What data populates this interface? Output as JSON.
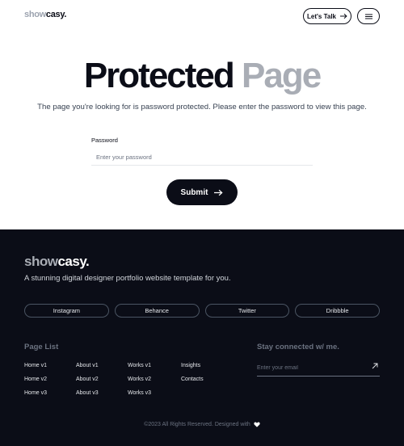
{
  "header": {
    "logo_light": "show",
    "logo_dark": "casy.",
    "talk_label": "Let's Talk",
    "talk_icon": "arrow-right-icon",
    "menu_icon": "hamburger-menu-icon"
  },
  "main": {
    "title_dark": "Protected",
    "title_light": "Page",
    "subtitle": "The page you're looking for is password protected. Please enter the password to view this page.",
    "password_label": "Password",
    "password_placeholder": "Enter your password",
    "password_value": "",
    "submit_label": "Submit",
    "submit_icon": "arrow-right-icon"
  },
  "footer": {
    "logo_light": "show",
    "logo_dark": "casy.",
    "tagline": "A stunning digital designer portfolio website template for you.",
    "socials": [
      "Instagram",
      "Behance",
      "Twitter",
      "Dribbble"
    ],
    "page_list_heading": "Page List",
    "page_links": [
      [
        "Home v1",
        "Home v2",
        "Home v3"
      ],
      [
        "About v1",
        "About v2",
        "About v3"
      ],
      [
        "Works v1",
        "Works v2",
        "Works v3"
      ],
      [
        "Insights",
        "Contacts"
      ]
    ],
    "stay_heading": "Stay connected w/ me.",
    "email_placeholder": "Enter your email",
    "email_icon": "arrow-up-right-icon",
    "copyright": "©2023 All Rights Reserved. Designed with",
    "heart_icon": "heart-icon"
  },
  "colors": {
    "dark": "#0b0d17",
    "muted": "#a9adb5",
    "white": "#ffffff"
  }
}
